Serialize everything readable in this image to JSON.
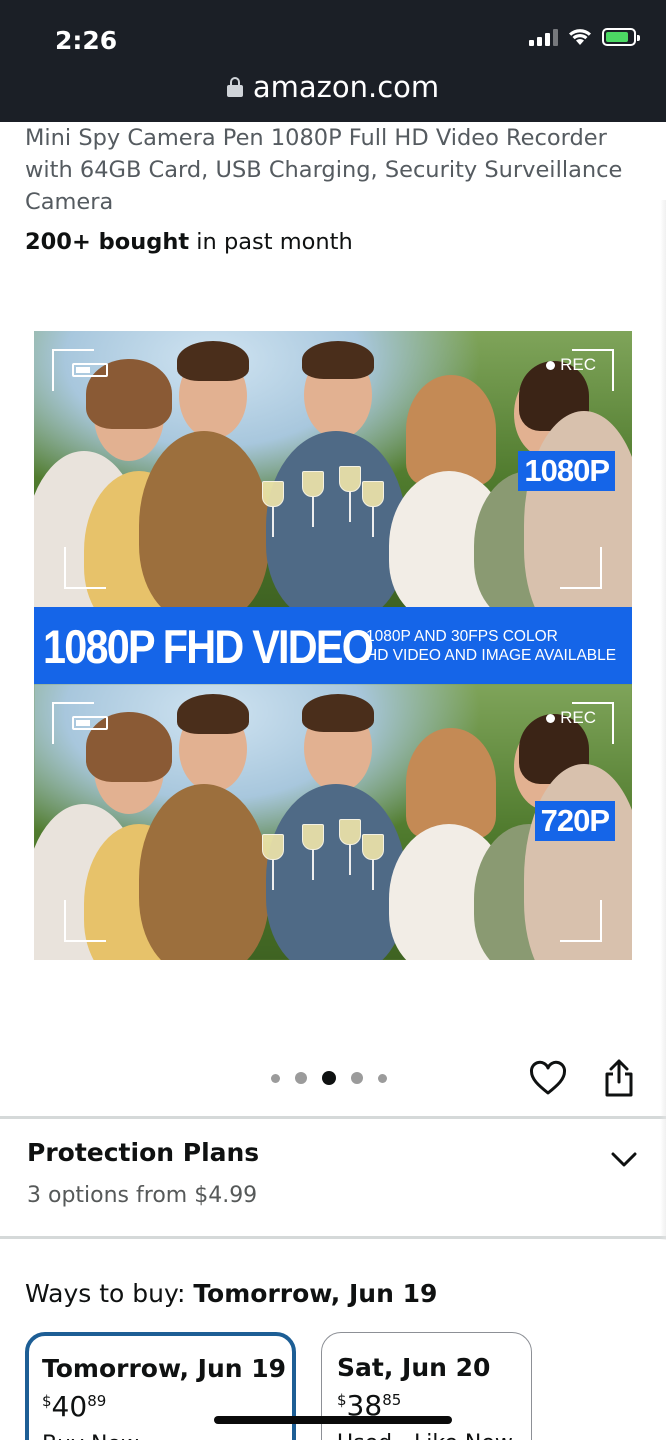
{
  "status_bar": {
    "time": "2:26"
  },
  "browser": {
    "url": "amazon.com"
  },
  "product": {
    "title": "Mini Spy Camera Pen 1080P Full HD Video Recorder with 64GB Card, USB Charging, Security Surveillance Camera",
    "bought_bold": "200+ bought",
    "bought_rest": " in past month"
  },
  "image": {
    "rec_label": "REC",
    "top_resolution": "1080P",
    "bottom_resolution": "720P",
    "banner_title": "1080P FHD VIDEO",
    "banner_line1": "1080P AND 30FPS COLOR",
    "banner_line2": "HD VIDEO AND IMAGE AVAILABLE"
  },
  "carousel": {
    "dot_count": 5,
    "active_index": 2
  },
  "protection_plans": {
    "title": "Protection Plans",
    "subtitle": "3 options from $4.99"
  },
  "ways_to_buy": {
    "label": "Ways to buy: ",
    "date": "Tomorrow, Jun 19",
    "options": [
      {
        "date": "Tomorrow, Jun 19",
        "currency": "$",
        "whole": "40",
        "fraction": "89",
        "type": "Buy Now",
        "selected": true
      },
      {
        "date": "Sat, Jun 20",
        "currency": "$",
        "whole": "38",
        "fraction": "85",
        "type": "Used - Like New",
        "selected": false
      }
    ]
  },
  "colors": {
    "accent": "#1565e8",
    "selected_border": "#1d5e95",
    "topbar": "#1b1f26"
  },
  "icons": [
    "lock-icon",
    "heart-icon",
    "share-icon",
    "chevron-down-icon",
    "wifi-icon",
    "battery-icon",
    "signal-icon"
  ]
}
